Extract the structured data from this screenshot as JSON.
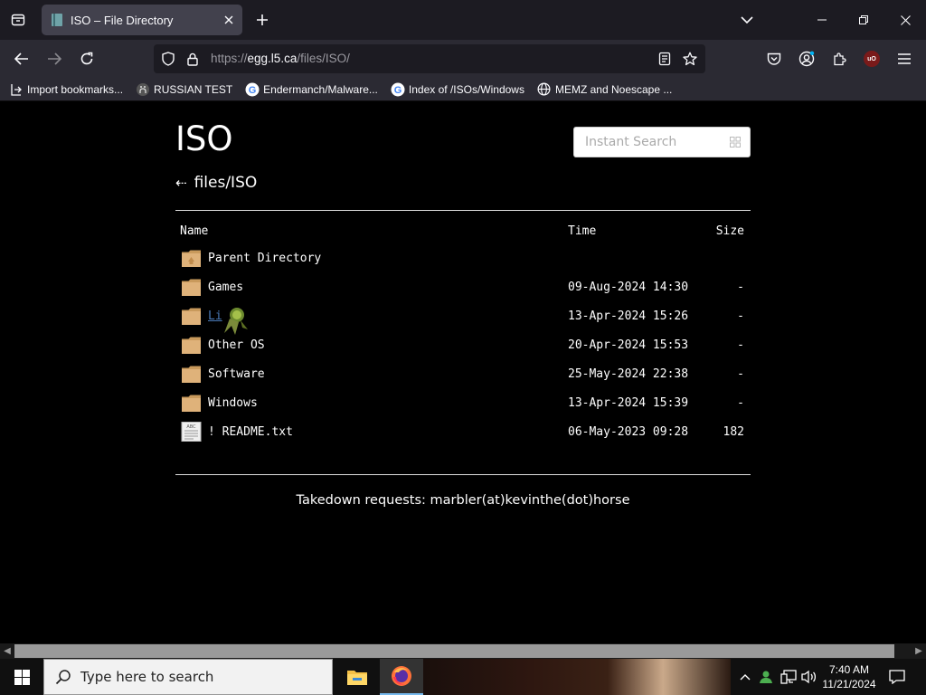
{
  "browser": {
    "tab_title": "ISO – File Directory",
    "url": {
      "prefix": "https://",
      "host": "egg.l5.ca",
      "path": "/files/ISO/"
    },
    "bookmarks": [
      {
        "label": "Import bookmarks...",
        "icon": "import-icon"
      },
      {
        "label": "RUSSIAN TEST",
        "icon": "github-icon"
      },
      {
        "label": "Endermanch/Malware...",
        "icon": "google-icon"
      },
      {
        "label": "Index of /ISOs/Windows",
        "icon": "google-icon"
      },
      {
        "label": "MEMZ and Noescape ...",
        "icon": "globe-icon"
      }
    ]
  },
  "page": {
    "title": "ISO",
    "search_placeholder": "Instant Search",
    "back_arrow": "⇠",
    "path": "files/ISO",
    "columns": {
      "name": "Name",
      "time": "Time",
      "size": "Size"
    },
    "entries": [
      {
        "name": "Parent Directory",
        "time": "",
        "size": "",
        "icon": "parent-folder-icon"
      },
      {
        "name": "Games",
        "time": "09-Aug-2024 14:30",
        "size": "-",
        "icon": "folder-icon"
      },
      {
        "name": "Li",
        "time": "13-Apr-2024 15:26",
        "size": "-",
        "icon": "folder-icon"
      },
      {
        "name": "Other OS",
        "time": "20-Apr-2024 15:53",
        "size": "-",
        "icon": "folder-icon"
      },
      {
        "name": "Software",
        "time": "25-May-2024 22:38",
        "size": "-",
        "icon": "folder-icon"
      },
      {
        "name": "Windows",
        "time": "13-Apr-2024 15:39",
        "size": "-",
        "icon": "folder-icon"
      },
      {
        "name": "! README.txt",
        "time": "06-May-2023 09:28",
        "size": "182",
        "icon": "text-file-icon"
      }
    ],
    "takedown": "Takedown requests: marbler(at)kevinthe(dot)horse"
  },
  "taskbar": {
    "search_placeholder": "Type here to search",
    "time": "7:40 AM",
    "date": "11/21/2024"
  },
  "colors": {
    "page_background": "#000000",
    "link": "#4a7ab8",
    "folder": "#d9a86a"
  }
}
